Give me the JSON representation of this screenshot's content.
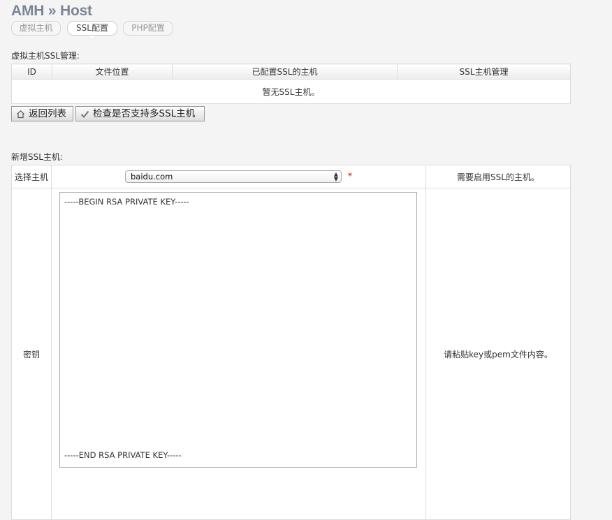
{
  "header": {
    "title": "AMH » Host"
  },
  "tabs": [
    {
      "label": "虚拟主机",
      "active": false
    },
    {
      "label": "SSL配置",
      "active": true
    },
    {
      "label": "PHP配置",
      "active": false
    }
  ],
  "ssl_list": {
    "section_label": "虚拟主机SSL管理:",
    "columns": [
      "ID",
      "文件位置",
      "已配置SSL的主机",
      "SSL主机管理"
    ],
    "empty_text": "暂无SSL主机。"
  },
  "actions": {
    "back_label": "返回列表",
    "check_label": "检查是否支持多SSL主机"
  },
  "new_ssl": {
    "section_label": "新增SSL主机:",
    "host_label": "选择主机",
    "host_value": "baidu.com",
    "required_mark": "*",
    "host_hint": "需要启用SSL的主机。",
    "key_label": "密钥",
    "key_line_begin": "-----BEGIN RSA PRIVATE KEY-----",
    "key_line_end": "-----END RSA PRIVATE KEY-----",
    "key_hint": "请粘贴key或pem文件内容。"
  }
}
